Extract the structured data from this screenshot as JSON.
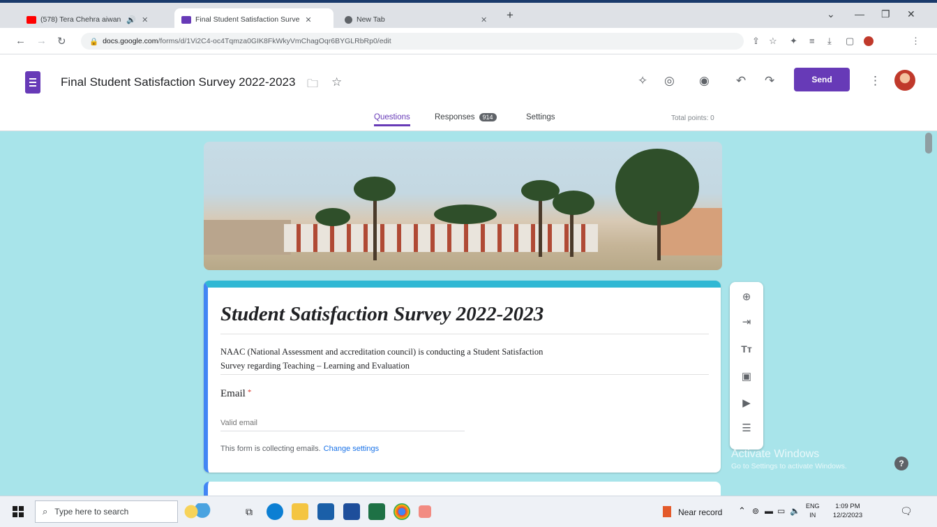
{
  "browser": {
    "tabs": [
      {
        "label": "(578) Tera Chehra aiwan",
        "active": false,
        "favicon_color": "#ff0000"
      },
      {
        "label": "Final Student Satisfaction Surve",
        "active": true,
        "favicon_color": "#673ab7"
      },
      {
        "label": "New Tab",
        "active": false,
        "favicon_color": "#5f6368"
      }
    ],
    "new_tab_label": "+",
    "url_host": "docs.google.com",
    "url_path": "/forms/d/1Vi2C4-oc4Tqmza0GIK8FkWkyVmChagOqr6BYGLRbRp0/edit"
  },
  "form_header": {
    "title": "Final Student Satisfaction Survey 2022-2023",
    "send_label": "Send",
    "tabs": [
      {
        "label": "Questions",
        "active": true
      },
      {
        "label": "Responses",
        "active": false,
        "badge": "914"
      },
      {
        "label": "Settings",
        "active": false
      }
    ],
    "total_points": "Total points: 0"
  },
  "form": {
    "title": "Student Satisfaction Survey 2022-2023",
    "description_line1": "NAAC (National Assessment and accreditation council) is conducting a Student Satisfaction",
    "description_line2": "Survey regarding Teaching – Learning and Evaluation",
    "email_label": "Email",
    "required_mark": "*",
    "email_placeholder": "Valid email",
    "email_note": "This form is collecting emails.",
    "change_settings": "Change settings"
  },
  "sidebar_tools": [
    "add-question-icon",
    "import-questions-icon",
    "add-title-icon",
    "add-image-icon",
    "add-video-icon",
    "add-section-icon"
  ],
  "watermark": {
    "line1": "Activate Windows",
    "line2": "Go to Settings to activate Windows."
  },
  "help_label": "?",
  "taskbar": {
    "search_placeholder": "Type here to search",
    "weather": "Near record",
    "lang1": "ENG",
    "lang2": "IN",
    "time": "1:09 PM",
    "date": "12/2/2023"
  },
  "colors": {
    "accent": "#673ab7",
    "canvas_bg": "#a8e4ea",
    "header_stripe": "#2fb8d4"
  }
}
